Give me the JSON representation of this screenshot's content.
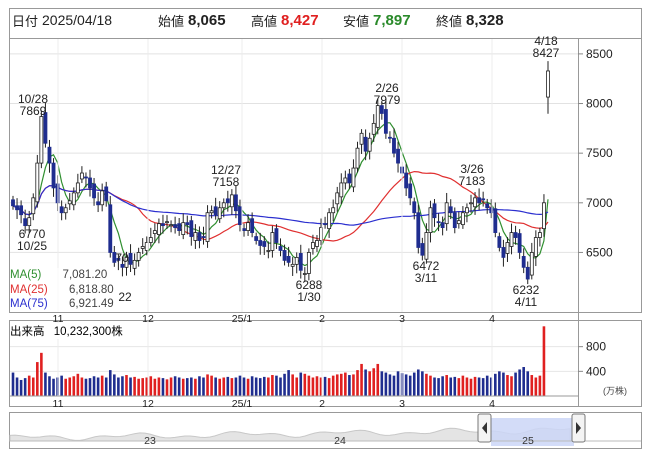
{
  "header": {
    "date_label": "日付",
    "date": "2025/04/18",
    "open_label": "始値",
    "open": "8,065",
    "high_label": "高値",
    "high": "8,427",
    "low_label": "安値",
    "low": "7,897",
    "close_label": "終値",
    "close": "8,328"
  },
  "colors": {
    "up": "#ffffff",
    "down": "#1f2d8f",
    "ma5": "#2f8f2f",
    "ma25": "#e03030",
    "ma75": "#2b2fcf",
    "vol_up": "#e02020",
    "vol_down": "#1f2d8f",
    "high_text": "#e02020",
    "low_text": "#2a8a2a"
  },
  "legend": {
    "ma5_label": "MA(5)",
    "ma5_value": "7,081.20",
    "ma25_label": "MA(25)",
    "ma25_value": "6,818.80",
    "ma75_label": "MA(75)",
    "ma75_value": "6,921.49",
    "volume_label": "出来高",
    "volume_value": "10,232,300株",
    "volume_unit": "(万株)"
  },
  "navigator": {
    "labels": [
      "23",
      "24",
      "25"
    ],
    "left_handle": "left-arrow",
    "right_handle": "right-arrow"
  },
  "chart_data": {
    "type": "candlestick",
    "y_ticks": [
      "8500",
      "8000",
      "7500",
      "7000",
      "6500"
    ],
    "ylim": [
      5900,
      8650
    ],
    "x_ticks": [
      "11",
      "12",
      "25/1",
      "2",
      "3",
      "4"
    ],
    "vol_ticks": [
      "800",
      "400"
    ],
    "annotations": [
      {
        "date": "10/28",
        "value": "7869"
      },
      {
        "date": "10/25",
        "value": "6770"
      },
      {
        "date": "12/27",
        "value": "7158"
      },
      {
        "date": "11/?",
        "value": "70"
      },
      {
        "date": "22",
        "value": ""
      },
      {
        "date": "1/30",
        "value": "6288"
      },
      {
        "date": "2/26",
        "value": "7979"
      },
      {
        "date": "3/26",
        "value": "7183"
      },
      {
        "date": "3/11",
        "value": "6472"
      },
      {
        "date": "4/11",
        "value": "6232"
      },
      {
        "date": "4/18",
        "value": "8427"
      }
    ],
    "close_series": [
      6970,
      6930,
      6880,
      6770,
      6850,
      7050,
      7400,
      7869,
      7600,
      7400,
      7150,
      7000,
      6900,
      6950,
      7020,
      7100,
      7200,
      7300,
      7250,
      7150,
      7050,
      6980,
      7120,
      7020,
      6500,
      6400,
      6420,
      6350,
      6450,
      6380,
      6420,
      6500,
      6560,
      6600,
      6650,
      6720,
      6790,
      6770,
      6810,
      6780,
      6750,
      6720,
      6800,
      6780,
      6660,
      6700,
      6620,
      6650,
      6900,
      6920,
      6880,
      6950,
      7000,
      7000,
      7080,
      6920,
      6780,
      6720,
      6800,
      6700,
      6620,
      6570,
      6560,
      6520,
      6700,
      6600,
      6520,
      6420,
      6400,
      6380,
      6450,
      6320,
      6288,
      6500,
      6600,
      6620,
      6750,
      6780,
      6900,
      6950,
      7100,
      7200,
      7250,
      7200,
      7350,
      7550,
      7700,
      7520,
      7650,
      7800,
      7979,
      7900,
      7700,
      7650,
      7500,
      7400,
      7300,
      7150,
      7050,
      6900,
      6550,
      6472,
      6700,
      6950,
      6850,
      6800,
      6750,
      7000,
      6900,
      6750,
      6820,
      6900,
      6950,
      7000,
      7050,
      7000,
      7030,
      6950,
      6900,
      6700,
      6550,
      6450,
      6600,
      6700,
      6650,
      6500,
      6350,
      6232,
      6500,
      6650,
      6700,
      7000,
      8328
    ],
    "volume_series": [
      380,
      300,
      260,
      290,
      330,
      300,
      550,
      700,
      380,
      320,
      280,
      300,
      330,
      280,
      300,
      320,
      360,
      300,
      280,
      290,
      320,
      300,
      330,
      300,
      420,
      350,
      300,
      320,
      340,
      300,
      310,
      280,
      290,
      300,
      320,
      280,
      300,
      290,
      270,
      300,
      320,
      300,
      280,
      290,
      300,
      280,
      320,
      300,
      350,
      330,
      300,
      280,
      300,
      310,
      290,
      300,
      330,
      300,
      280,
      320,
      300,
      290,
      310,
      300,
      340,
      330,
      300,
      360,
      420,
      350,
      300,
      380,
      360,
      330,
      300,
      320,
      300,
      310,
      290,
      330,
      350,
      360,
      380,
      340,
      350,
      420,
      520,
      430,
      400,
      450,
      520,
      400,
      380,
      350,
      330,
      400,
      370,
      350,
      330,
      380,
      430,
      400,
      360,
      330,
      300,
      290,
      320,
      340,
      300,
      310,
      290,
      330,
      300,
      280,
      310,
      300,
      290,
      330,
      300,
      360,
      400,
      380,
      340,
      320,
      380,
      430,
      470,
      400,
      340,
      300,
      330,
      1130
    ]
  }
}
